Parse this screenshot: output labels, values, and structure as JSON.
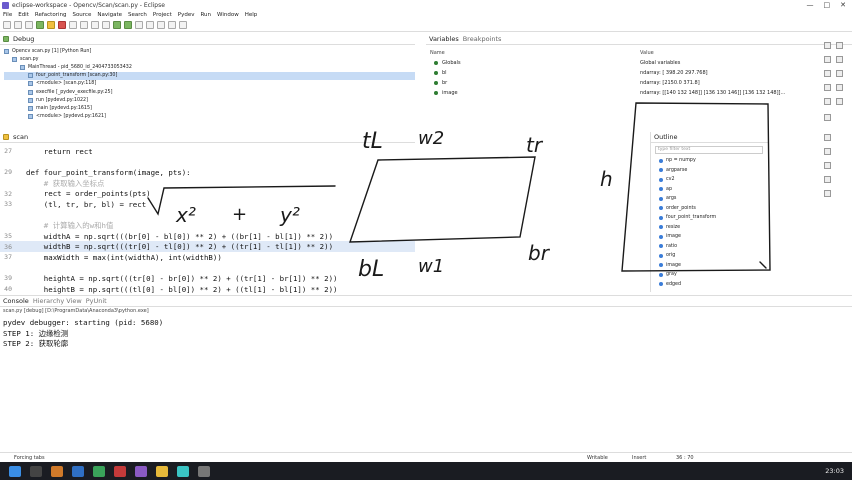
{
  "window": {
    "title": "eclipse-workspace - Opencv/Scan/scan.py - Eclipse",
    "controls": [
      "—",
      "□",
      "✕"
    ]
  },
  "menu": [
    "File",
    "Edit",
    "Refactoring",
    "Source",
    "Navigate",
    "Search",
    "Project",
    "Pydev",
    "Run",
    "Window",
    "Help"
  ],
  "debug": {
    "tab": "Debug",
    "tree": [
      "Opencv scan.py [1] [Python Run]",
      "scan.py",
      "MainThread - pid_5680_id_2404733053432",
      "four_point_transform [scan.py:30]",
      "<module> [scan.py:118]",
      "execfile [_pydev_execfile.py:25]",
      "run [pydevd.py:1022]",
      "main [pydevd.py:1615]",
      "<module> [pydevd.py:1621]"
    ]
  },
  "variables": {
    "tabs": [
      "Variables",
      "Breakpoints"
    ],
    "headers": [
      "Name",
      "Value"
    ],
    "rows": [
      {
        "name": "Globals",
        "value": "Global variables"
      },
      {
        "name": "bl",
        "value": "ndarray: [ 398.20 297.768]"
      },
      {
        "name": "br",
        "value": "ndarray: [2150.0 371.8]"
      },
      {
        "name": "image",
        "value": "ndarray: [[140 132 148]] [136 130 146]] [136 132 148]]..."
      }
    ]
  },
  "editor": {
    "tab": "scan",
    "lines": [
      {
        "n": "27",
        "code": "    return rect",
        "hl": false
      },
      {
        "n": "",
        "code": "",
        "hl": false
      },
      {
        "n": "29",
        "code": "def four_point_transform(image, pts):",
        "hl": false
      },
      {
        "n": "",
        "code": "    # 获取输入坐标点",
        "hl": false,
        "comment": true
      },
      {
        "n": "32",
        "code": "    rect = order_points(pts)",
        "hl": false
      },
      {
        "n": "33",
        "code": "    (tl, tr, br, bl) = rect",
        "hl": false
      },
      {
        "n": "",
        "code": "",
        "hl": false
      },
      {
        "n": "",
        "code": "    # 计算输入的w和h值",
        "hl": false,
        "comment": true
      },
      {
        "n": "35",
        "code": "    widthA = np.sqrt(((br[0] - bl[0]) ** 2) + ((br[1] - bl[1]) ** 2))",
        "hl": false
      },
      {
        "n": "36",
        "code": "    widthB = np.sqrt(((tr[0] - tl[0]) ** 2) + ((tr[1] - tl[1]) ** 2))",
        "hl": true
      },
      {
        "n": "37",
        "code": "    maxWidth = max(int(widthA), int(widthB))",
        "hl": false
      },
      {
        "n": "",
        "code": "",
        "hl": false
      },
      {
        "n": "39",
        "code": "    heightA = np.sqrt(((tr[0] - br[0]) ** 2) + ((tr[1] - br[1]) ** 2))",
        "hl": false
      },
      {
        "n": "40",
        "code": "    heightB = np.sqrt(((tl[0] - bl[0]) ** 2) + ((tl[1] - bl[1]) ** 2))",
        "hl": false
      }
    ]
  },
  "outline": {
    "tab": "Outline",
    "filter": "type filter text",
    "items": [
      "np = numpy",
      "argparse",
      "cv2",
      "ap",
      "args",
      "order_points",
      "four_point_transform",
      "resize",
      "image",
      "ratio",
      "orig",
      "image",
      "gray",
      "edged"
    ]
  },
  "console": {
    "tabs": [
      "Console",
      "Hierarchy View",
      "PyUnit"
    ],
    "process": "scan.py [debug] [D:\\ProgramData\\Anaconda3\\python.exe]",
    "lines": [
      "pydev debugger: starting (pid: 5680)",
      "STEP 1: 边缘检测",
      "STEP 2: 获取轮廓"
    ]
  },
  "status": {
    "left": "Forcing tabs",
    "writable": "Writable",
    "insert": "Insert",
    "pos": "36 : 70"
  },
  "taskbar": {
    "time": "23:03"
  },
  "annotations": {
    "tl": "tL",
    "w2": "w2",
    "tr": "tr",
    "h": "h",
    "bl": "bL",
    "w1": "w1",
    "br": "br",
    "x2": "x²",
    "plus": "+",
    "y2": "y²"
  }
}
